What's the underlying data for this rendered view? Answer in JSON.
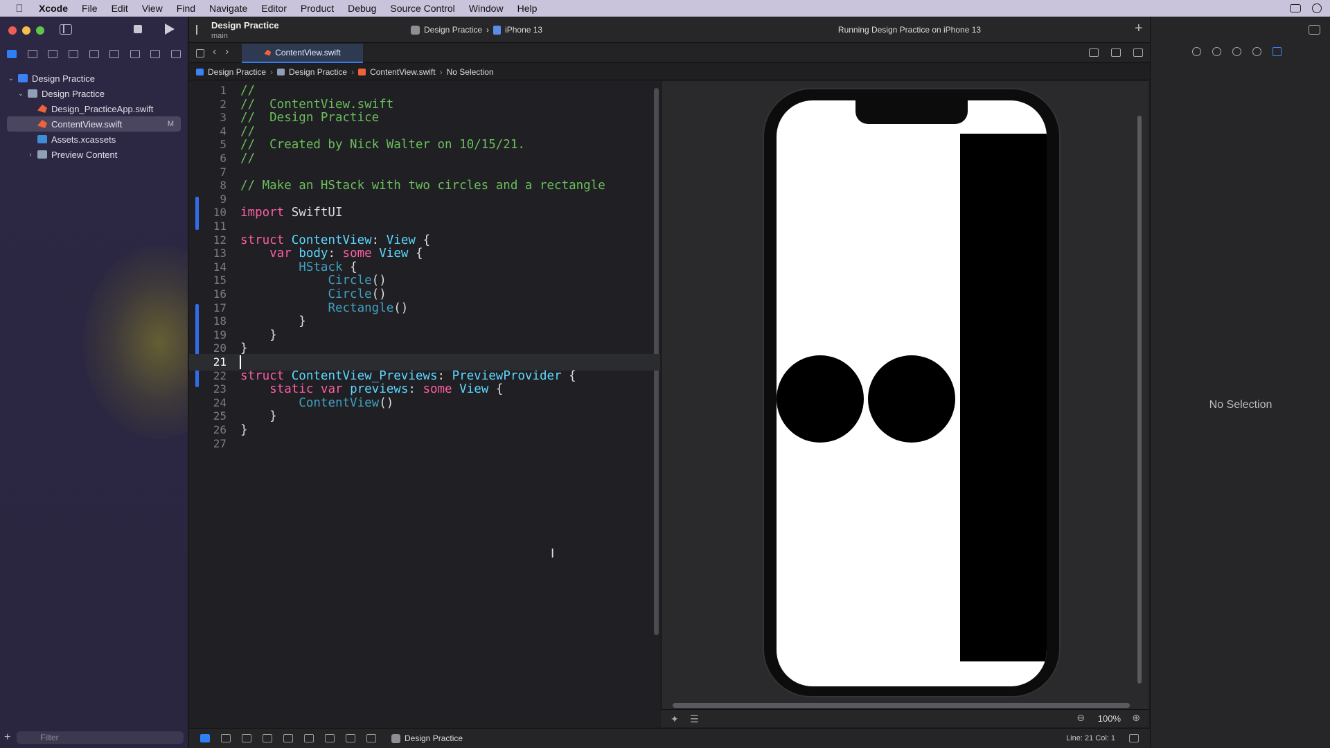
{
  "menubar": {
    "app": "Xcode",
    "items": [
      "File",
      "Edit",
      "View",
      "Find",
      "Navigate",
      "Editor",
      "Product",
      "Debug",
      "Source Control",
      "Window",
      "Help"
    ]
  },
  "toolbar": {
    "project": "Design Practice",
    "branch": "main",
    "scheme": "Design Practice",
    "device": "iPhone 13",
    "status": "Running Design Practice on iPhone 13"
  },
  "navigator": {
    "items": [
      {
        "label": "Design Practice",
        "type": "project",
        "indent": 0
      },
      {
        "label": "Design Practice",
        "type": "folder",
        "indent": 1
      },
      {
        "label": "Design_PracticeApp.swift",
        "type": "swift",
        "indent": 2
      },
      {
        "label": "ContentView.swift",
        "type": "swift",
        "indent": 2,
        "badge": "M",
        "selected": true
      },
      {
        "label": "Assets.xcassets",
        "type": "assets",
        "indent": 2
      },
      {
        "label": "Preview Content",
        "type": "folder",
        "indent": 2
      }
    ],
    "filter_placeholder": "Filter"
  },
  "tab": {
    "label": "ContentView.swift"
  },
  "jumpbar": [
    "Design Practice",
    "Design Practice",
    "ContentView.swift",
    "No Selection"
  ],
  "editor": {
    "current_line": 21,
    "lines": [
      "//",
      "//  ContentView.swift",
      "//  Design Practice",
      "//",
      "//  Created by Nick Walter on 10/15/21.",
      "//",
      "",
      "// Make an HStack with two circles and a rectangle",
      "",
      "import SwiftUI",
      "",
      "struct ContentView: View {",
      "    var body: some View {",
      "        HStack {",
      "            Circle()",
      "            Circle()",
      "            Rectangle()",
      "        }",
      "    }",
      "}",
      "",
      "struct ContentView_Previews: PreviewProvider {",
      "    static var previews: some View {",
      "        ContentView()",
      "    }",
      "}",
      ""
    ]
  },
  "canvas": {
    "zoom": "100%"
  },
  "inspector": {
    "empty_label": "No Selection"
  },
  "debug": {
    "target": "Design Practice",
    "position": "Line: 21  Col: 1"
  }
}
